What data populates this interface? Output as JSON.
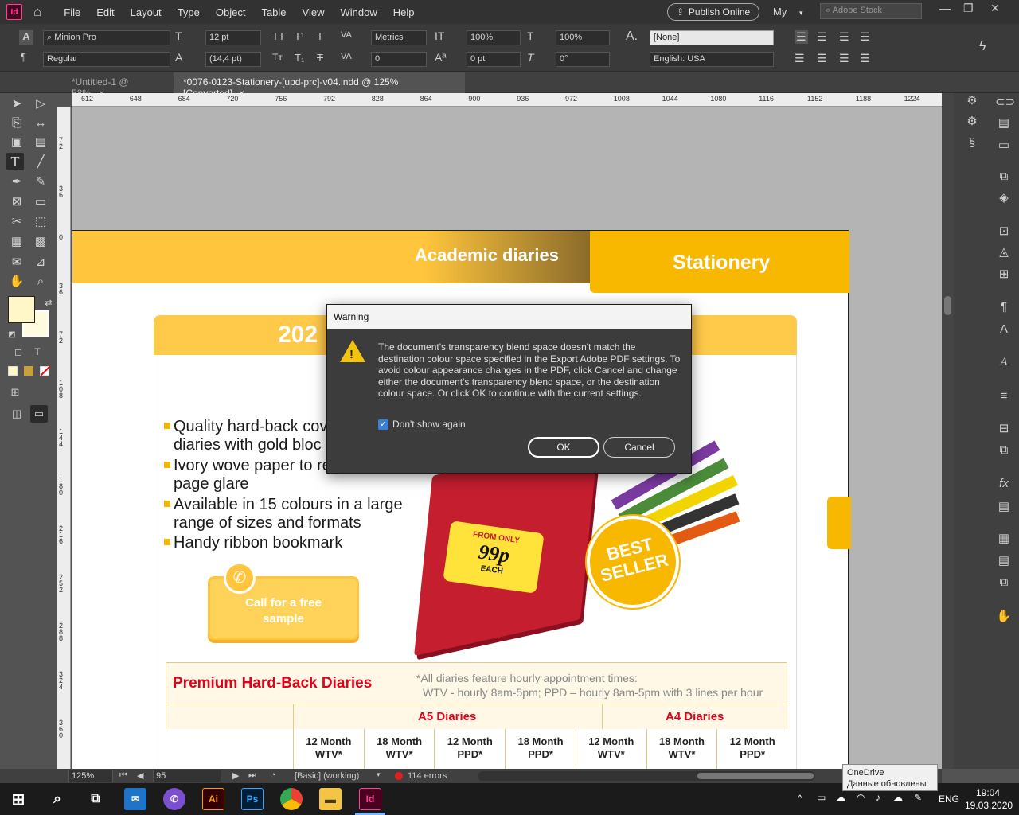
{
  "app": {
    "logo": "Id"
  },
  "menu": [
    "File",
    "Edit",
    "Layout",
    "Type",
    "Object",
    "Table",
    "View",
    "Window",
    "Help"
  ],
  "header": {
    "publish": "Publish Online",
    "workspace": "My",
    "stock_placeholder": "Adobe Stock"
  },
  "control": {
    "font_family": "Minion Pro",
    "font_style": "Regular",
    "font_size": "12 pt",
    "leading": "(14,4 pt)",
    "kerning": "Metrics",
    "tracking": "0",
    "vscale": "100%",
    "hscale": "100%",
    "baseline": "0 pt",
    "skew": "0°",
    "char_style": "[None]",
    "language": "English: USA"
  },
  "tabs": [
    {
      "label": "*Untitled-1 @ 58%"
    },
    {
      "label": "*0076-0123-Stationery-[upd-prc]-v04.indd @ 125% [Converted]"
    }
  ],
  "ruler": {
    "h": [
      "612",
      "648",
      "684",
      "720",
      "756",
      "792",
      "828",
      "864",
      "900",
      "936",
      "972",
      "1008",
      "1044",
      "1080",
      "1116",
      "1152",
      "1188",
      "1224"
    ],
    "v": [
      "72",
      "36",
      "0",
      "36",
      "72",
      "108",
      "144",
      "180",
      "216",
      "252",
      "288",
      "324",
      "360"
    ]
  },
  "doc": {
    "header_left": "Academic diaries",
    "header_right": "Stationery",
    "year": "202",
    "bullets": [
      [
        "Quality hard-back cov",
        "diaries with gold bloc"
      ],
      [
        "Ivory wove paper to re",
        "page glare"
      ],
      [
        "Available in 15 colours in a large",
        "range of sizes and formats"
      ],
      [
        "Handy ribbon bookmark"
      ]
    ],
    "call_line1": "Call for a free",
    "call_line2": "sample",
    "sticker_from": "FROM ONLY",
    "sticker_price": "99p",
    "sticker_each": "EACH",
    "badge_line1": "BEST",
    "badge_line2": "SELLER",
    "table_title": "Premium Hard-Back Diaries",
    "table_note1": "*All diaries feature hourly appointment times:",
    "table_note2": "WTV - hourly 8am-5pm; PPD – hourly 8am-5pm with 3 lines per hour",
    "group_a5": "A5 Diaries",
    "group_a4": "A4 Diaries",
    "columns": [
      [
        "12 Month",
        "WTV*"
      ],
      [
        "18 Month",
        "WTV*"
      ],
      [
        "12 Month",
        "PPD*"
      ],
      [
        "18 Month",
        "PPD*"
      ],
      [
        "12 Month",
        "WTV*"
      ],
      [
        "18 Month",
        "WTV*"
      ],
      [
        "12 Month",
        "PPD*"
      ]
    ]
  },
  "dialog": {
    "title": "Warning",
    "message": "The document's transparency blend space doesn't match the destination colour space specified in the Export Adobe PDF settings. To avoid colour appearance changes in the PDF, click Cancel and change either the document's transparency blend space, or the destination colour space. Or click OK to continue with the current settings.",
    "checkbox": "Don't show again",
    "checked": true,
    "ok": "OK",
    "cancel": "Cancel"
  },
  "status": {
    "zoom": "125%",
    "page": "95",
    "style": "[Basic] (working)",
    "errors": "114 errors"
  },
  "toast": {
    "line1": "OneDrive",
    "line2": "Данные обновлены"
  },
  "taskbar": {
    "lang": "ENG",
    "time": "19:04",
    "date": "19.03.2020",
    "ai": "Ai",
    "ps": "Ps",
    "id": "Id"
  },
  "colors": {
    "accent_yellow": "#f9b800",
    "light_yellow": "#ffc94a",
    "table_red": "#e2001a",
    "book_red": "#c41e2f"
  }
}
